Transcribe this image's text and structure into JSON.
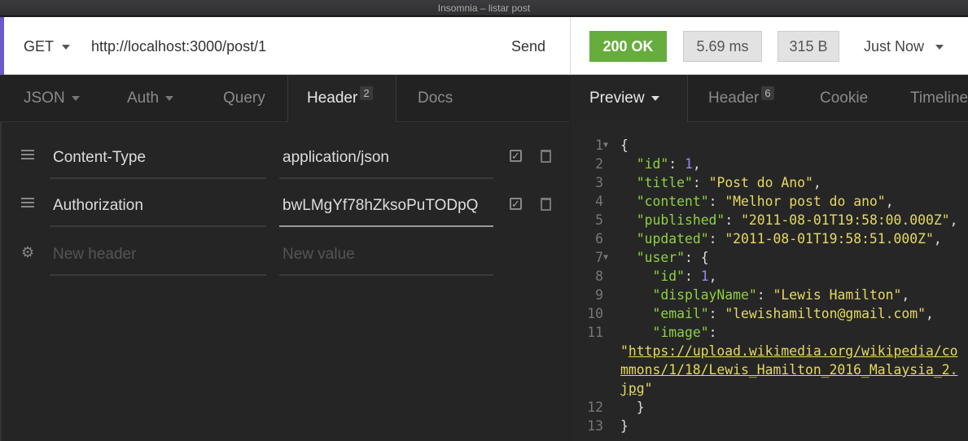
{
  "window_title": "Insomnia – listar post",
  "request": {
    "method": "GET",
    "url": "http://localhost:3000/post/1",
    "send_label": "Send"
  },
  "response_meta": {
    "status": "200 OK",
    "time": "5.69 ms",
    "size": "315 B",
    "when": "Just Now",
    "status_color": "#66ad3e"
  },
  "request_tabs": [
    {
      "label": "JSON"
    },
    {
      "label": "Auth"
    },
    {
      "label": "Query"
    },
    {
      "label": "Header",
      "badge": "2"
    },
    {
      "label": "Docs"
    }
  ],
  "response_tabs": [
    {
      "label": "Preview"
    },
    {
      "label": "Header",
      "badge": "6"
    },
    {
      "label": "Cookie"
    },
    {
      "label": "Timeline"
    }
  ],
  "headers": [
    {
      "name": "Content-Type",
      "value": "application/json",
      "enabled": true
    },
    {
      "name": "Authorization",
      "value": "bwLMgYf78hZksoPuTODpQ",
      "enabled": true
    }
  ],
  "new_header": {
    "name_placeholder": "New header",
    "value_placeholder": "New value"
  },
  "code_lines": [
    {
      "num": "1",
      "fold": true,
      "segs": [
        [
          "p",
          "{"
        ]
      ]
    },
    {
      "num": "2",
      "segs": [
        [
          "p",
          "  "
        ],
        [
          "k",
          "\"id\""
        ],
        [
          "p",
          ": "
        ],
        [
          "n",
          "1"
        ],
        [
          "p",
          ","
        ]
      ]
    },
    {
      "num": "3",
      "segs": [
        [
          "p",
          "  "
        ],
        [
          "k",
          "\"title\""
        ],
        [
          "p",
          ": "
        ],
        [
          "s",
          "\"Post do Ano\""
        ],
        [
          "p",
          ","
        ]
      ]
    },
    {
      "num": "4",
      "segs": [
        [
          "p",
          "  "
        ],
        [
          "k",
          "\"content\""
        ],
        [
          "p",
          ": "
        ],
        [
          "s",
          "\"Melhor post do ano\""
        ],
        [
          "p",
          ","
        ]
      ]
    },
    {
      "num": "5",
      "segs": [
        [
          "p",
          "  "
        ],
        [
          "k",
          "\"published\""
        ],
        [
          "p",
          ": "
        ],
        [
          "s",
          "\"2011-08-01T19:58:00.000Z\""
        ],
        [
          "p",
          ","
        ]
      ]
    },
    {
      "num": "6",
      "segs": [
        [
          "p",
          "  "
        ],
        [
          "k",
          "\"updated\""
        ],
        [
          "p",
          ": "
        ],
        [
          "s",
          "\"2011-08-01T19:58:51.000Z\""
        ],
        [
          "p",
          ","
        ]
      ]
    },
    {
      "num": "7",
      "fold": true,
      "segs": [
        [
          "p",
          "  "
        ],
        [
          "k",
          "\"user\""
        ],
        [
          "p",
          ": {"
        ]
      ]
    },
    {
      "num": "8",
      "segs": [
        [
          "p",
          "    "
        ],
        [
          "k",
          "\"id\""
        ],
        [
          "p",
          ": "
        ],
        [
          "n",
          "1"
        ],
        [
          "p",
          ","
        ]
      ]
    },
    {
      "num": "9",
      "segs": [
        [
          "p",
          "    "
        ],
        [
          "k",
          "\"displayName\""
        ],
        [
          "p",
          ": "
        ],
        [
          "s",
          "\"Lewis Hamilton\""
        ],
        [
          "p",
          ","
        ]
      ]
    },
    {
      "num": "10",
      "segs": [
        [
          "p",
          "    "
        ],
        [
          "k",
          "\"email\""
        ],
        [
          "p",
          ": "
        ],
        [
          "s",
          "\"lewishamilton@gmail.com\""
        ],
        [
          "p",
          ","
        ]
      ]
    },
    {
      "num": "11",
      "segs": [
        [
          "p",
          "    "
        ],
        [
          "k",
          "\"image\""
        ],
        [
          "p",
          ":"
        ]
      ]
    },
    {
      "num": "",
      "segs": [
        [
          "s",
          "\""
        ],
        [
          "u",
          "https://upload.wikimedia.org/wikipedia/co"
        ]
      ]
    },
    {
      "num": "",
      "segs": [
        [
          "u",
          "mmons/1/18/Lewis_Hamilton_2016_Malaysia_2."
        ]
      ]
    },
    {
      "num": "",
      "segs": [
        [
          "u",
          "jpg"
        ],
        [
          "s",
          "\""
        ]
      ]
    },
    {
      "num": "12",
      "segs": [
        [
          "p",
          "  }"
        ]
      ]
    },
    {
      "num": "13",
      "segs": [
        [
          "p",
          "}"
        ]
      ]
    }
  ]
}
